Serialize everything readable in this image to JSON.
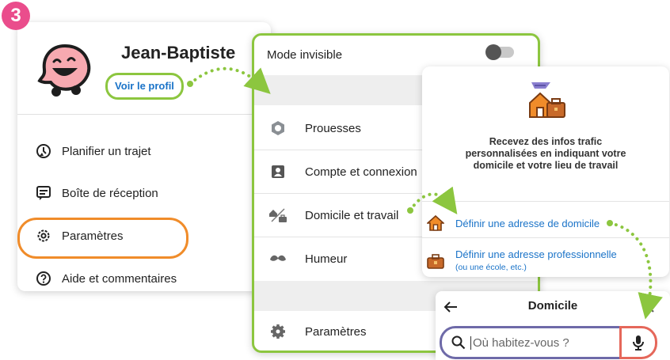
{
  "step_badge": "3",
  "profile": {
    "name": "Jean-Baptiste",
    "view_profile": "Voir le profil"
  },
  "menu": [
    {
      "label": "Planifier un trajet",
      "icon": "clock-plan-icon"
    },
    {
      "label": "Boîte de réception",
      "icon": "inbox-icon"
    },
    {
      "label": "Paramètres",
      "icon": "gear-icon"
    },
    {
      "label": "Aide et commentaires",
      "icon": "help-icon"
    }
  ],
  "settings": {
    "invisible_mode": "Mode invisible",
    "items": [
      {
        "label": "Prouesses",
        "icon": "badge-icon"
      },
      {
        "label": "Compte et connexion",
        "icon": "account-card-icon"
      },
      {
        "label": "Domicile et travail",
        "icon": "home-work-icon"
      },
      {
        "label": "Humeur",
        "icon": "mustache-icon"
      },
      {
        "label": "Paramètres",
        "icon": "gear-icon"
      }
    ]
  },
  "home_work": {
    "description": [
      "Recevez des infos trafic",
      "personnalisées en indiquant votre",
      "domicile et votre lieu de travail"
    ],
    "set_home": "Définir une adresse de domicile",
    "set_work": "Définir une adresse professionnelle",
    "set_work_sub": "(ou une école, etc.)"
  },
  "domicile": {
    "title": "Domicile",
    "search_placeholder": "Où habitez-vous ?"
  },
  "colors": {
    "badge": "#ea4d8c",
    "green": "#8cc63f",
    "orange": "#f08c2a",
    "link": "#1a73c8",
    "search_border": "#6e6aa8",
    "mic_border": "#e5675a"
  }
}
